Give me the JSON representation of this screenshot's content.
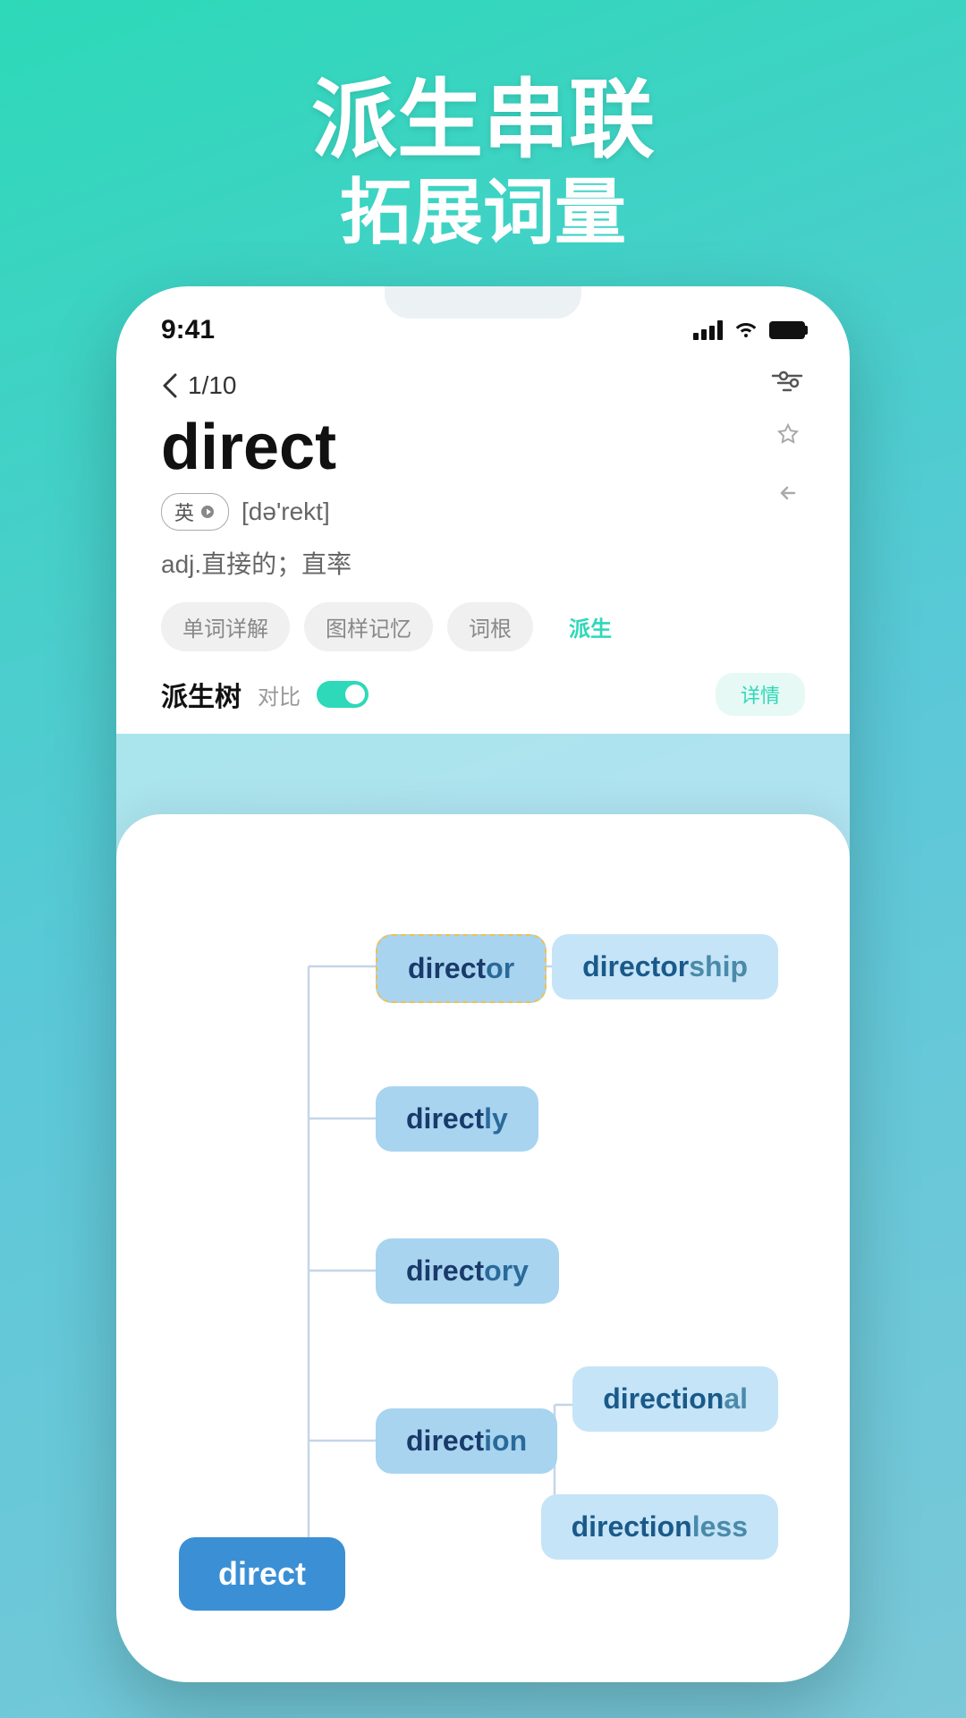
{
  "header": {
    "line1": "派生串联",
    "line2": "拓展词量"
  },
  "status_bar": {
    "time": "9:41",
    "page": "1/10"
  },
  "word": {
    "text": "direct",
    "phonetic_tag": "英",
    "phonetic": "[də'rekt]",
    "definition": "adj.直接的；直率"
  },
  "tabs": [
    {
      "label": "单词详解",
      "active": false
    },
    {
      "label": "图样记忆",
      "active": false
    },
    {
      "label": "词根",
      "active": false
    },
    {
      "label": "派生",
      "active": true
    }
  ],
  "derivation": {
    "title": "派生树",
    "compare_label": "对比",
    "detail_label": "详情"
  },
  "nodes": [
    {
      "id": "root",
      "prefix": "direct",
      "suffix": ""
    },
    {
      "id": "director",
      "prefix": "direct",
      "suffix": "or"
    },
    {
      "id": "directorship",
      "prefix": "director",
      "suffix": "ship"
    },
    {
      "id": "directly",
      "prefix": "direct",
      "suffix": "ly"
    },
    {
      "id": "directory",
      "prefix": "direct",
      "suffix": "ory"
    },
    {
      "id": "direction",
      "prefix": "direct",
      "suffix": "ion"
    },
    {
      "id": "directional",
      "prefix": "direction",
      "suffix": "al"
    },
    {
      "id": "directionless",
      "prefix": "direction",
      "suffix": "less"
    }
  ],
  "colors": {
    "gradient_start": "#2dd9b8",
    "gradient_end": "#7ac8d8",
    "node_primary": "#3b8fd4",
    "node_secondary": "#a8d4f0",
    "node_tertiary": "#c5e4f7",
    "node_text_dark": "#1a3a6a",
    "node_text_med": "#2a6a9a",
    "accent": "#2dd9b8"
  }
}
